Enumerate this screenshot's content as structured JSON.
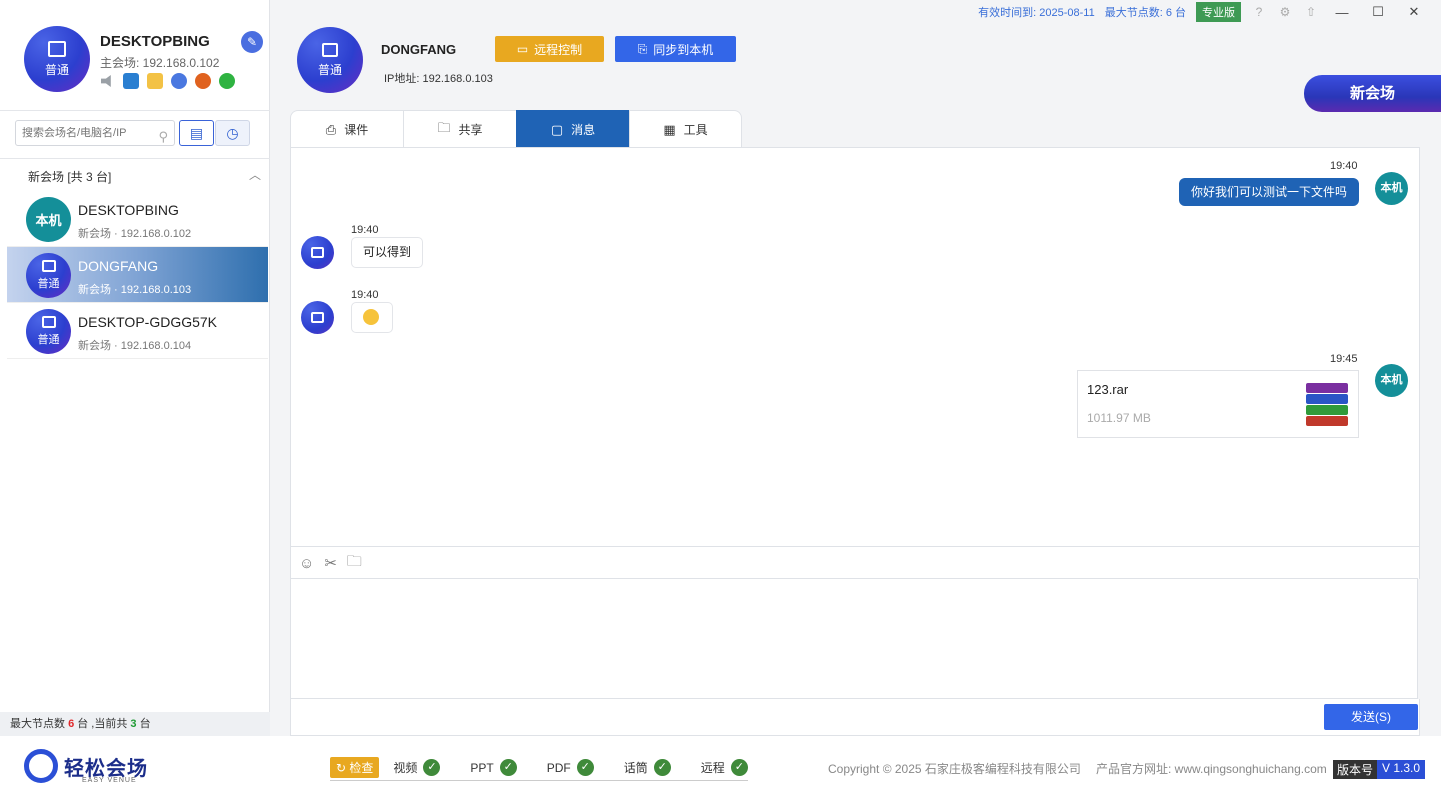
{
  "self": {
    "name": "DESKTOPBING",
    "role": "普通",
    "main_session": "主会场: 192.168.0.102",
    "status_icons": [
      "speaker-muted-icon",
      "screen-icon",
      "folder-icon",
      "chrome-icon",
      "music-icon",
      "wechat-icon"
    ],
    "edit_icon": "edit-icon"
  },
  "search": {
    "placeholder": "搜索会场名/电脑名/IP"
  },
  "group": {
    "title": "新会场   [共 3 台]"
  },
  "devices": [
    {
      "name": "DESKTOPBING",
      "sub": "新会场 · 192.168.0.102",
      "avatar": "本机",
      "type": "local"
    },
    {
      "name": "DONGFANG",
      "sub": "新会场 · 192.168.0.103",
      "avatar": "普通",
      "type": "normal",
      "selected": true
    },
    {
      "name": "DESKTOP-GDGG57K",
      "sub": "新会场 · 192.168.0.104",
      "avatar": "普通",
      "type": "normal"
    }
  ],
  "left_footer": {
    "prefix": "最大节点数 ",
    "max": "6",
    "mid": " 台 ,当前共 ",
    "count": "3",
    "suffix": " 台"
  },
  "topbar": {
    "expiry": "有效时间到: 2025-08-11",
    "max_nodes": "最大节点数: 6 台",
    "edition": "专业版"
  },
  "peer": {
    "name": "DONGFANG",
    "role": "普通",
    "ip": "IP地址: 192.168.0.103",
    "remote_label": "远程控制",
    "sync_label": "同步到本机"
  },
  "new_room_label": "新会场",
  "tabs": [
    {
      "label": "课件",
      "icon": "scanner-icon"
    },
    {
      "label": "共享",
      "icon": "share-folder-icon"
    },
    {
      "label": "消息",
      "icon": "message-icon",
      "active": true
    },
    {
      "label": "工具",
      "icon": "grid-icon"
    }
  ],
  "messages": [
    {
      "from": "me",
      "time": "19:40",
      "text": "你好我们可以测试一下文件吗",
      "avatar": "本机"
    },
    {
      "from": "peer",
      "time": "19:40",
      "text": "可以得到"
    },
    {
      "from": "peer",
      "time": "19:40",
      "text": "emoji"
    },
    {
      "from": "me",
      "time": "19:45",
      "file": {
        "name": "123.rar",
        "size": "1011.97 MB"
      },
      "avatar": "本机"
    }
  ],
  "send_label": "发送(S)",
  "footer": {
    "logo_text": "轻松会场",
    "logo_sub": "EASY VENUE",
    "check_label": "检查",
    "checks": [
      "视频",
      "PPT",
      "PDF",
      "话筒",
      "远程"
    ],
    "copyright": "Copyright © 2025 石家庄极客编程科技有限公司",
    "website": "产品官方网址: www.qingsonghuichang.com",
    "version_key": "版本号",
    "version_value": "V 1.3.0"
  },
  "colors": {
    "primary": "#1f63b5",
    "accent": "#3366e8",
    "warning": "#e8a820",
    "local_avatar": "#148f99"
  }
}
